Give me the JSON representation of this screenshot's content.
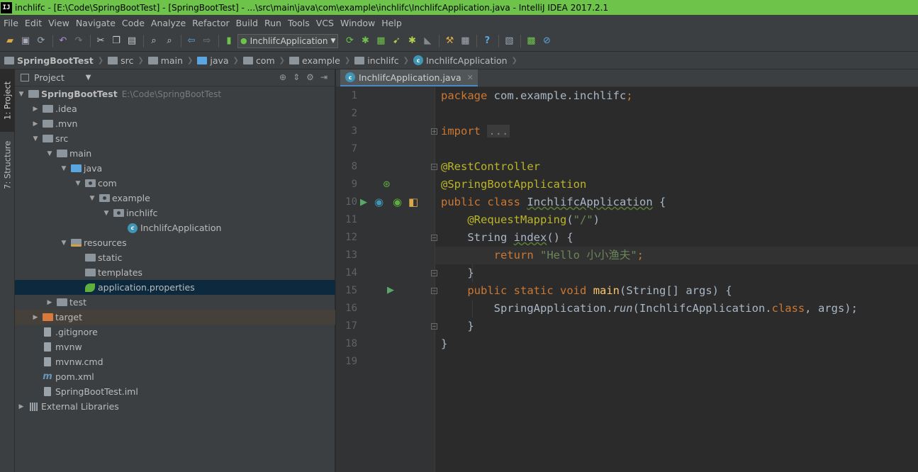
{
  "window": {
    "title": "inchlifc - [E:\\Code\\SpringBootTest] - [SpringBootTest] - ...\\src\\main\\java\\com\\example\\inchlifc\\InchlifcApplication.java - IntelliJ IDEA 2017.2.1",
    "logo": "IJ"
  },
  "menu": [
    "File",
    "Edit",
    "View",
    "Navigate",
    "Code",
    "Analyze",
    "Refactor",
    "Build",
    "Run",
    "Tools",
    "VCS",
    "Window",
    "Help"
  ],
  "toolbar": {
    "run_config": "InchlifcApplication"
  },
  "breadcrumbs": [
    "SpringBootTest",
    "src",
    "main",
    "java",
    "com",
    "example",
    "inchlifc",
    "InchlifcApplication"
  ],
  "left_tabs": {
    "project": "1: Project",
    "structure": "7: Structure"
  },
  "project_panel": {
    "header": "Project"
  },
  "tree": [
    {
      "label": "SpringBootTest",
      "path": "E:\\Code\\SpringBootTest"
    },
    {
      "label": ".idea"
    },
    {
      "label": ".mvn"
    },
    {
      "label": "src"
    },
    {
      "label": "main"
    },
    {
      "label": "java"
    },
    {
      "label": "com"
    },
    {
      "label": "example"
    },
    {
      "label": "inchlifc"
    },
    {
      "label": "InchlifcApplication"
    },
    {
      "label": "resources"
    },
    {
      "label": "static"
    },
    {
      "label": "templates"
    },
    {
      "label": "application.properties"
    },
    {
      "label": "test"
    },
    {
      "label": "target"
    },
    {
      "label": ".gitignore"
    },
    {
      "label": "mvnw"
    },
    {
      "label": "mvnw.cmd"
    },
    {
      "label": "pom.xml"
    },
    {
      "label": "SpringBootTest.iml"
    },
    {
      "label": "External Libraries"
    }
  ],
  "editor": {
    "tab": "InchlifcApplication.java",
    "line_numbers": [
      "1",
      "2",
      "3",
      "7",
      "8",
      "9",
      "10",
      "11",
      "12",
      "13",
      "14",
      "15",
      "16",
      "17",
      "18",
      "19"
    ],
    "code": {
      "pkg_kw": "package",
      "pkg_name": " com.example.inchlifc",
      "import_kw": "import",
      "import_fold": "...",
      "ann1": "@RestController",
      "ann2": "@SpringBootApplication",
      "public": "public",
      "class": "class",
      "class_name": "InchlifcApplication",
      "ann3": "@RequestMapping",
      "mapping_value": "\"/\"",
      "string_type": "String",
      "index": "index",
      "return": "return",
      "hello": "\"Hello 小小渔夫\"",
      "static": "static",
      "void": "void",
      "main": "main",
      "main_params": "(String[] args) {",
      "spring_app": "SpringApplication.",
      "run": "run",
      "run_args1": "(InchlifcApplication.",
      "class_lit": "class",
      ", args": ", args);"
    }
  },
  "colors": {
    "title_bar": "#6ec44a",
    "selection": "#0d293e",
    "keyword": "#cc7832",
    "string": "#6a8759",
    "annotation": "#bbb529",
    "method": "#ffc66d"
  }
}
